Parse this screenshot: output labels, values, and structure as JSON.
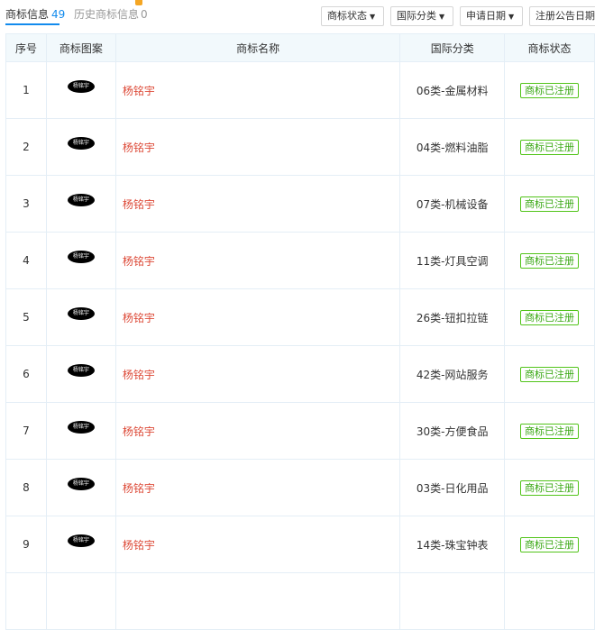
{
  "tabs": {
    "active": {
      "label": "商标信息",
      "count": "49"
    },
    "history": {
      "label": "历史商标信息",
      "count": "0"
    }
  },
  "filters": [
    {
      "label": "商标状态"
    },
    {
      "label": "国际分类"
    },
    {
      "label": "申请日期"
    },
    {
      "label": "注册公告日期"
    }
  ],
  "table": {
    "headers": [
      "序号",
      "商标图案",
      "商标名称",
      "国际分类",
      "商标状态"
    ],
    "rows": [
      {
        "no": "1",
        "logo_text": "杨铭宇",
        "name": "杨铭宇",
        "class": "06类-金属材料",
        "status": "商标已注册"
      },
      {
        "no": "2",
        "logo_text": "杨铭宇",
        "name": "杨铭宇",
        "class": "04类-燃料油脂",
        "status": "商标已注册"
      },
      {
        "no": "3",
        "logo_text": "杨铭宇",
        "name": "杨铭宇",
        "class": "07类-机械设备",
        "status": "商标已注册"
      },
      {
        "no": "4",
        "logo_text": "杨铭宇",
        "name": "杨铭宇",
        "class": "11类-灯具空调",
        "status": "商标已注册"
      },
      {
        "no": "5",
        "logo_text": "杨铭宇",
        "name": "杨铭宇",
        "class": "26类-钮扣拉链",
        "status": "商标已注册"
      },
      {
        "no": "6",
        "logo_text": "杨铭宇",
        "name": "杨铭宇",
        "class": "42类-网站服务",
        "status": "商标已注册"
      },
      {
        "no": "7",
        "logo_text": "杨铭宇",
        "name": "杨铭宇",
        "class": "30类-方便食品",
        "status": "商标已注册"
      },
      {
        "no": "8",
        "logo_text": "杨铭宇",
        "name": "杨铭宇",
        "class": "03类-日化用品",
        "status": "商标已注册"
      },
      {
        "no": "9",
        "logo_text": "杨铭宇",
        "name": "杨铭宇",
        "class": "14类-珠宝钟表",
        "status": "商标已注册"
      }
    ]
  },
  "colors": {
    "accent": "#128bed",
    "name_text": "#dd4b39",
    "status_green": "#52c41a",
    "header_bg": "#f2f9fc"
  }
}
